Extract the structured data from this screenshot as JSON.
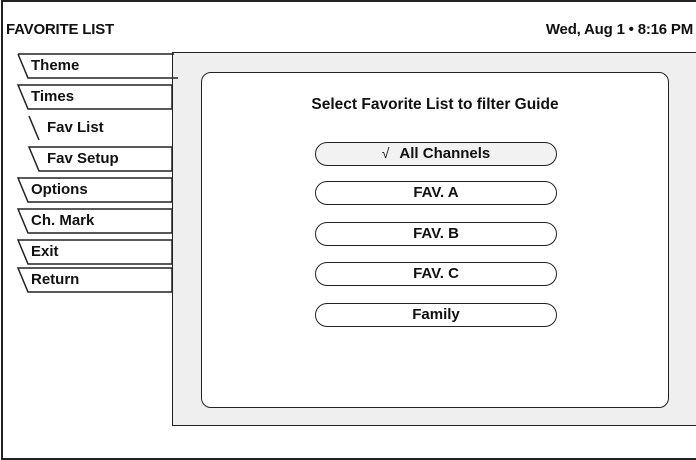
{
  "header": {
    "title": "FAVORITE LIST",
    "datetime": "Wed, Aug 1 • 8:16 PM"
  },
  "menu": {
    "items": [
      {
        "label": "Theme",
        "active": false
      },
      {
        "label": "Times",
        "active": false
      },
      {
        "label": "Fav List",
        "active": true
      },
      {
        "label": "Fav Setup",
        "active": false
      },
      {
        "label": "Options",
        "active": false
      },
      {
        "label": "Ch. Mark",
        "active": false
      },
      {
        "label": "Exit",
        "active": false
      },
      {
        "label": "Return",
        "active": false
      }
    ]
  },
  "main": {
    "prompt": "Select Favorite List to filter Guide",
    "check_glyph": "√",
    "options": [
      {
        "label": "All Channels",
        "selected": true
      },
      {
        "label": "FAV. A",
        "selected": false
      },
      {
        "label": "FAV. B",
        "selected": false
      },
      {
        "label": "FAV. C",
        "selected": false
      },
      {
        "label": "Family",
        "selected": false
      }
    ]
  }
}
